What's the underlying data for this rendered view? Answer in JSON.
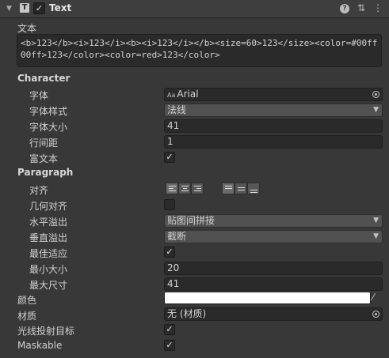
{
  "component": {
    "title": "Text",
    "icon": "text-component-icon",
    "enabled": true
  },
  "text_label": "文本",
  "text_value": "<b>123</b><i>123</i><b><i>123</i></b><size=60>123</size><color=#00ff00ff>123</color><color=red>123</color>",
  "character": {
    "section": "Character",
    "font_label": "字体",
    "font_value": "Arial",
    "font_style_label": "字体样式",
    "font_style_value": "法线",
    "font_size_label": "字体大小",
    "font_size_value": "41",
    "line_spacing_label": "行间距",
    "line_spacing_value": "1",
    "rich_text_label": "富文本",
    "rich_text": true
  },
  "paragraph": {
    "section": "Paragraph",
    "alignment_label": "对齐",
    "align_by_geometry_label": "几何对齐",
    "align_by_geometry": false,
    "h_overflow_label": "水平溢出",
    "h_overflow_value": "贴图间拼接",
    "v_overflow_label": "垂直溢出",
    "v_overflow_value": "截断",
    "best_fit_label": "最佳适应",
    "best_fit": true,
    "min_size_label": "最小大小",
    "min_size_value": "20",
    "max_size_label": "最大尺寸",
    "max_size_value": "41"
  },
  "color_label": "颜色",
  "color_value": "#ffffff",
  "material_label": "材质",
  "material_value": "无 (材质)",
  "raycast_label": "光线投射目标",
  "raycast": true,
  "maskable_label": "Maskable",
  "maskable": true
}
